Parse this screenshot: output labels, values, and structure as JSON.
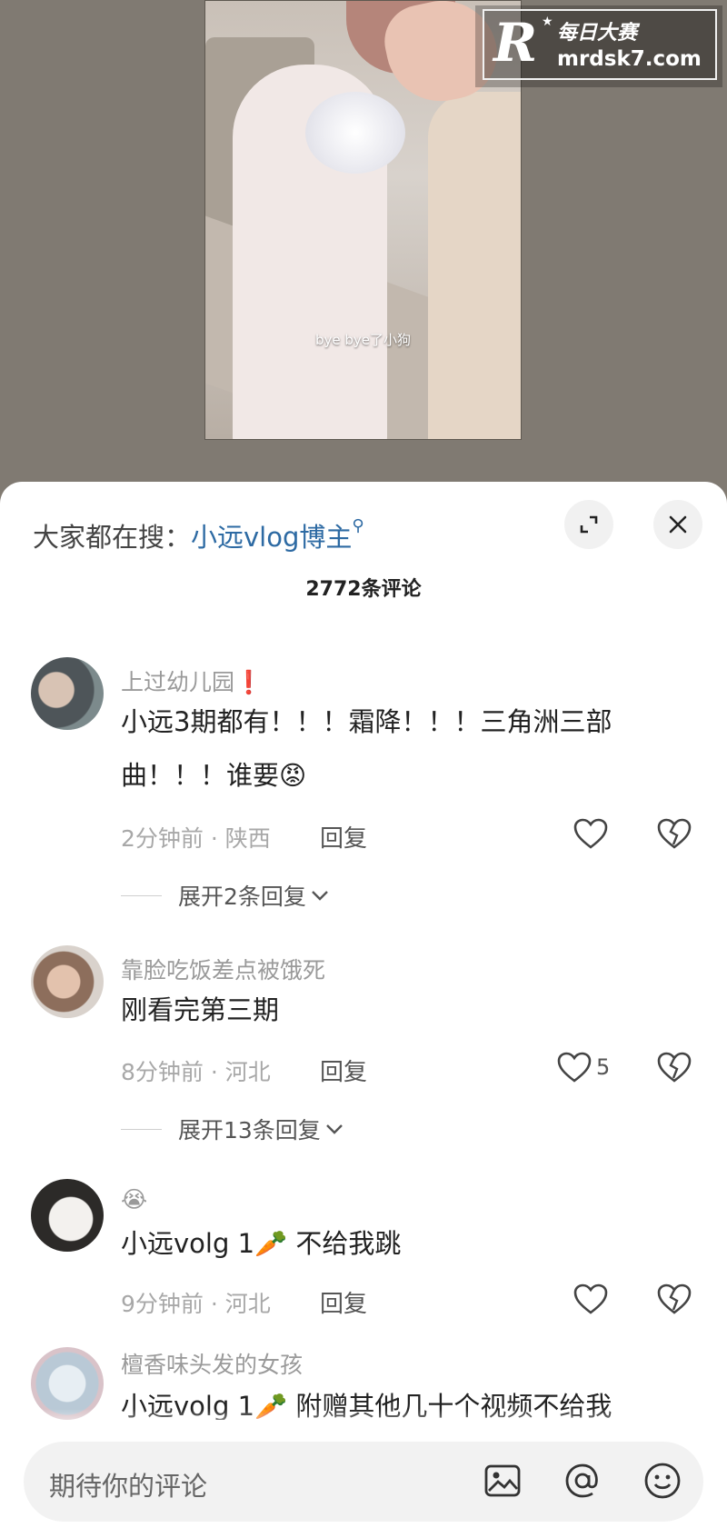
{
  "video": {
    "subtitle": "bye bye了小狗",
    "watermark_cn": "每日大赛",
    "watermark_site": "mrdsk7.com",
    "watermark_letter": "R"
  },
  "sheet": {
    "search_prefix": "大家都在搜：",
    "search_keyword": "小远vlog博主",
    "comment_count": "2772条评论"
  },
  "comments": [
    {
      "username": "上过幼儿园❗",
      "text": "小远3期都有！！！霜降！！！三角洲三部曲！！！谁要😡",
      "meta": "2分钟前 · 陕西",
      "reply_label": "回复",
      "likes": "",
      "expand": "展开2条回复"
    },
    {
      "username": "靠脸吃饭差点被饿死",
      "text": "刚看完第三期",
      "meta": "8分钟前 · 河北",
      "reply_label": "回复",
      "likes": "5",
      "expand": "展开13条回复"
    },
    {
      "username": "😭",
      "text": "小远volg 1🥕 不给我跳",
      "meta": "9分钟前 · 河北",
      "reply_label": "回复",
      "likes": ""
    },
    {
      "username": "檀香味头发的女孩",
      "text": "小远volg 1🥕 附赠其他几十个视频不给我"
    }
  ],
  "input": {
    "placeholder": "期待你的评论"
  },
  "colors": {
    "accent_link": "#2d6aa3",
    "video_bg": "#807a72"
  }
}
